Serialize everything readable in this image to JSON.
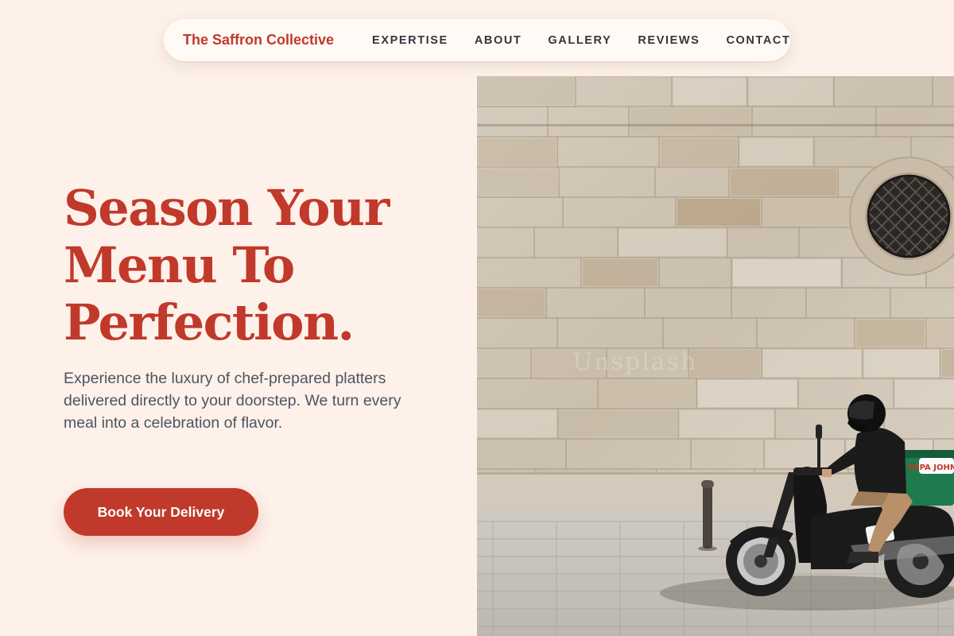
{
  "nav": {
    "brand": "The Saffron Collective",
    "links": [
      "EXPERTISE",
      "ABOUT",
      "GALLERY",
      "REVIEWS",
      "CONTACT"
    ]
  },
  "hero": {
    "title_lines": [
      "Season Your",
      "Menu To",
      "Perfection."
    ],
    "description": "Experience the luxury of chef-prepared platters delivered directly to your doorstep. We turn every meal into a celebration of flavor.",
    "cta_label": "Book Your Delivery"
  },
  "image": {
    "box_text": "PAPA JOHN'S",
    "watermark": "Unsplash"
  },
  "colors": {
    "accent": "#c0392b",
    "background": "#fdf1e9",
    "text": "#4d5561",
    "nav_text": "#33373d"
  }
}
